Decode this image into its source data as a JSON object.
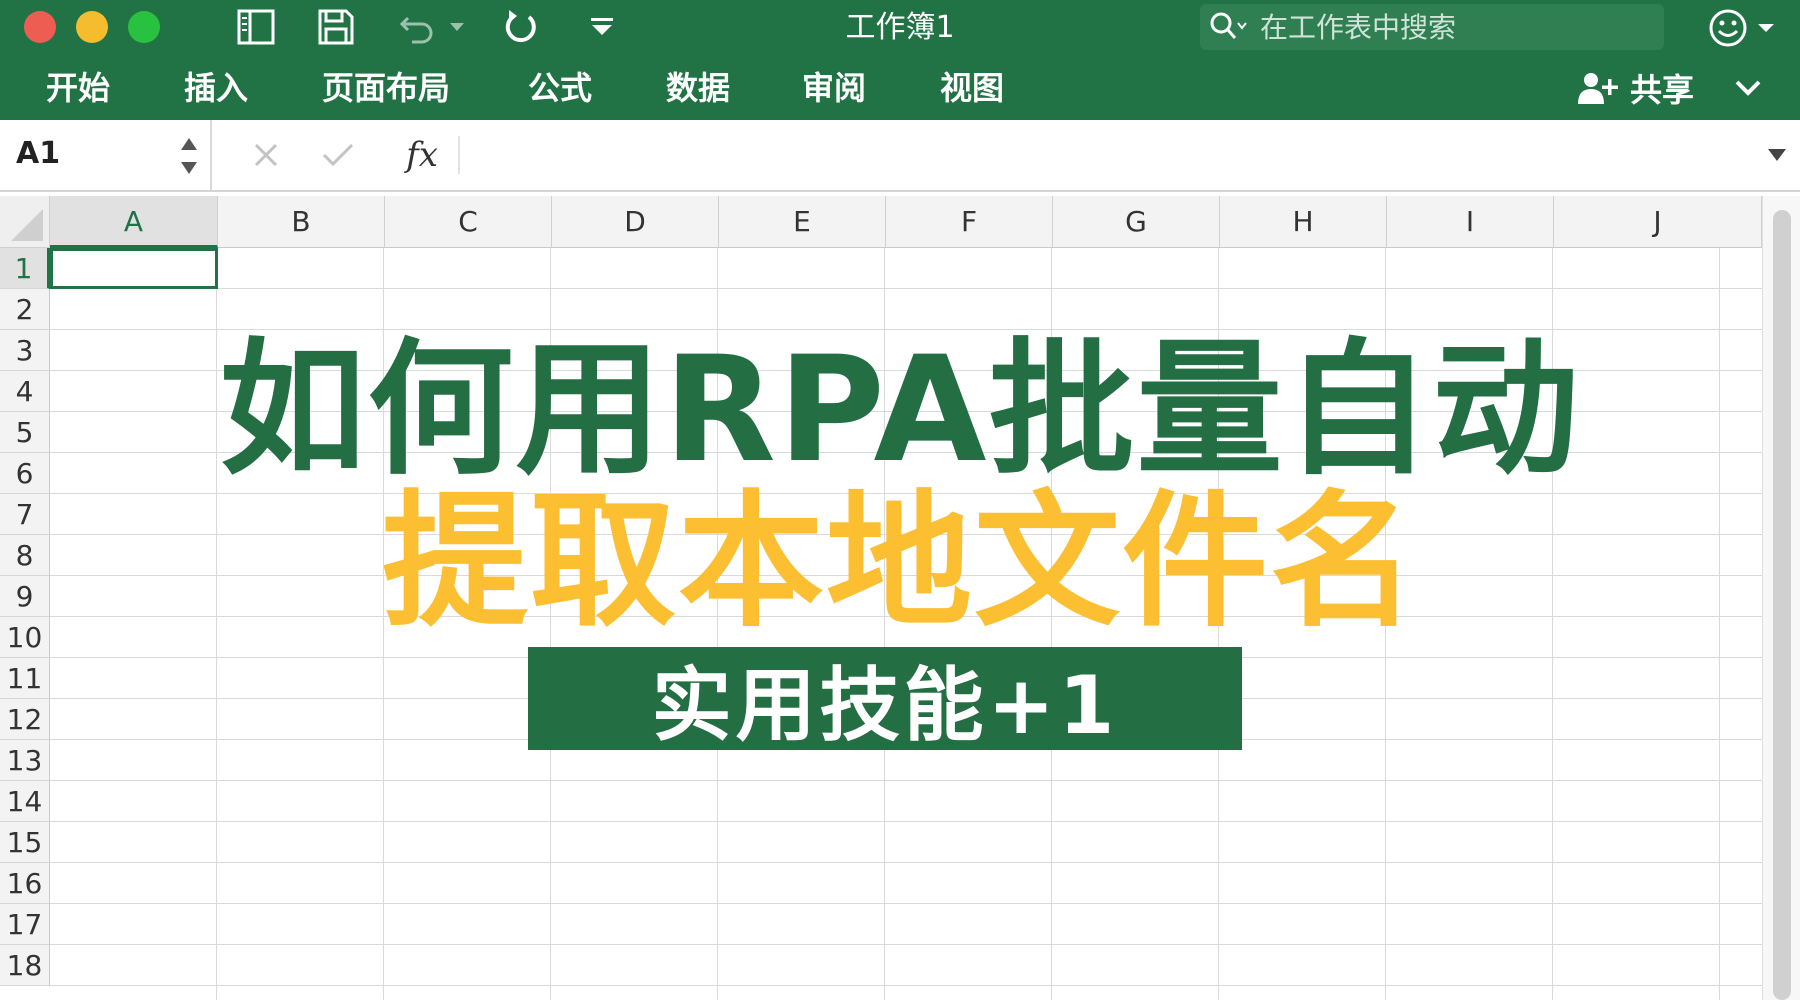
{
  "window": {
    "title": "工作簿1",
    "search_placeholder": "在工作表中搜索"
  },
  "ribbon": {
    "tabs": [
      "开始",
      "插入",
      "页面布局",
      "公式",
      "数据",
      "审阅",
      "视图"
    ],
    "share_label": "共享"
  },
  "formula_bar": {
    "name_box": "A1",
    "fx_label": "fx",
    "formula": ""
  },
  "grid": {
    "columns": [
      "A",
      "B",
      "C",
      "D",
      "E",
      "F",
      "G",
      "H",
      "I",
      "J"
    ],
    "rows": [
      "1",
      "2",
      "3",
      "4",
      "5",
      "6",
      "7",
      "8",
      "9",
      "10",
      "11",
      "12",
      "13",
      "14",
      "15",
      "16",
      "17",
      "18"
    ],
    "selected_cell": "A1"
  },
  "overlay": {
    "headline": "如何用RPA批量自动",
    "subheadline": "提取本地文件名",
    "tagline": "实用技能+1"
  },
  "colors": {
    "excel_green": "#217346",
    "headline_green": "#236e43",
    "headline_yellow": "#fbbf31",
    "close": "#ee5d52",
    "minimize": "#f5bd2e",
    "maximize": "#29c240"
  },
  "icons": {
    "sidebar_toggle": "sidebar-icon",
    "save": "save-icon",
    "undo": "undo-icon",
    "redo": "redo-icon",
    "customize": "customize-toolbar-icon",
    "search": "search-icon",
    "feedback": "smiley-icon",
    "share": "add-person-icon"
  }
}
